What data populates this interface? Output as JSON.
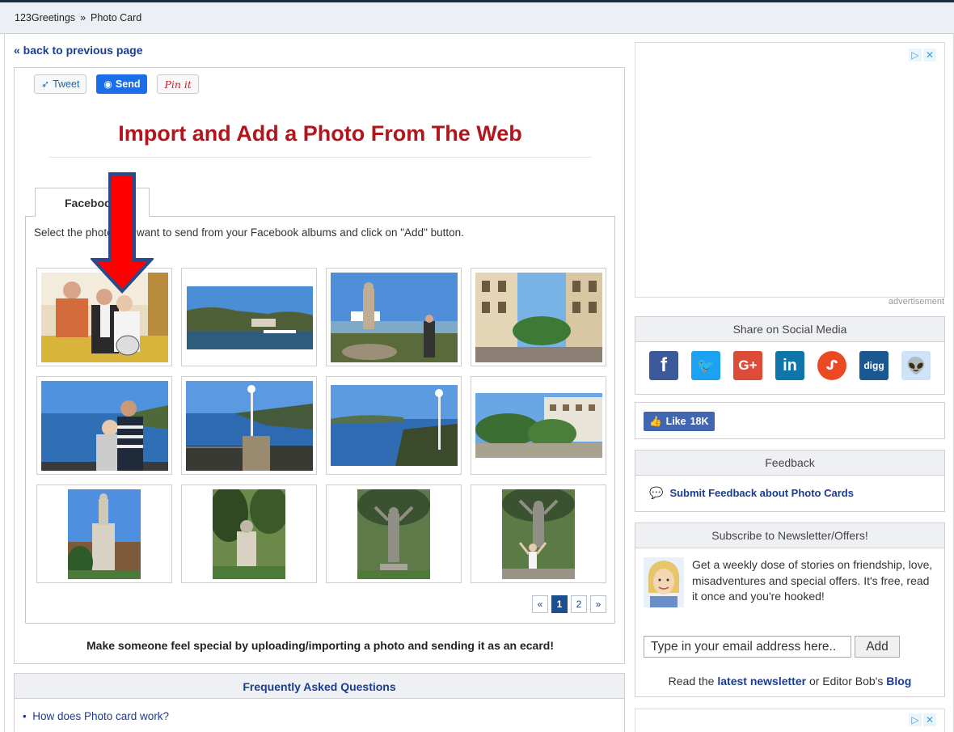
{
  "breadcrumb": {
    "home": "123Greetings",
    "sep": "»",
    "current": "Photo Card"
  },
  "back_link": "« back to previous page",
  "share_buttons": {
    "tweet": "Tweet",
    "send": "Send",
    "pin": "Pin it"
  },
  "page_title": "Import and Add a Photo From The Web",
  "tab_label": "Facebook",
  "instruction": "Select the photo you want to send from your Facebook albums and click on \"Add\" button.",
  "pagination": {
    "prev": "«",
    "pages": [
      "1",
      "2"
    ],
    "active_page": "1",
    "next": "»"
  },
  "tagline": "Make someone feel special by uploading/importing a photo and sending it as an ecard!",
  "faq": {
    "title": "Frequently Asked Questions",
    "items": [
      "How does Photo card work?"
    ]
  },
  "ad": {
    "label": "advertisement"
  },
  "social_panel": {
    "title": "Share on Social Media",
    "icons": [
      "facebook-icon",
      "twitter-icon",
      "google-plus-icon",
      "linkedin-icon",
      "stumbleupon-icon",
      "digg-icon",
      "reddit-icon"
    ]
  },
  "like_button": {
    "label": "Like",
    "count": "18K"
  },
  "feedback": {
    "title": "Feedback",
    "link": "Submit Feedback about Photo Cards"
  },
  "newsletter": {
    "title": "Subscribe to Newsletter/Offers!",
    "text": "Get a weekly dose of stories on friendship, love, misadventures and special offers. It's free, read it once and you're hooked!",
    "email_placeholder": "Type in your email address here..",
    "add_label": "Add",
    "footer_prefix": "Read the",
    "footer_link1": "latest newsletter",
    "footer_mid": "or Editor Bob's",
    "footer_link2": "Blog"
  },
  "colors": {
    "title_red": "#b1161c",
    "link_blue": "#1a3d8f",
    "arrow_red": "#ff0000",
    "arrow_outline": "#2b4a8b"
  }
}
